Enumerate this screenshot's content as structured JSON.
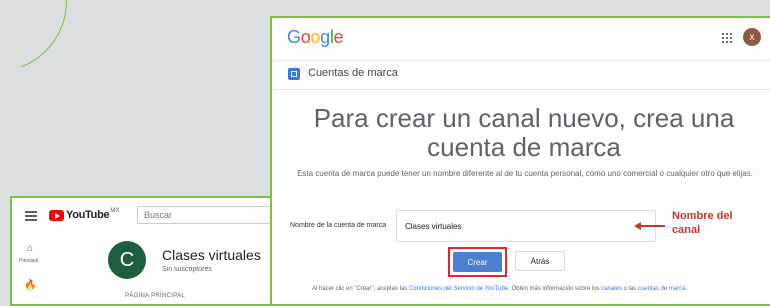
{
  "youtube": {
    "logo_text": "YouTube",
    "logo_region": "MX",
    "search_placeholder": "Buscar",
    "sidebar": [
      {
        "icon": "home-icon",
        "glyph": "⌂",
        "label": "Principal"
      },
      {
        "icon": "trending-icon",
        "glyph": "🔥",
        "label": ""
      }
    ],
    "channel": {
      "avatar_letter": "C",
      "name": "Clases virtuales",
      "subscribers": "Sin suscriptores",
      "page_label": "PÁGINA PRINCIPAL"
    }
  },
  "google": {
    "logo_letters": [
      {
        "ch": "G",
        "color": "#4285F4"
      },
      {
        "ch": "o",
        "color": "#EA4335"
      },
      {
        "ch": "o",
        "color": "#FBBC05"
      },
      {
        "ch": "g",
        "color": "#4285F4"
      },
      {
        "ch": "l",
        "color": "#34A853"
      },
      {
        "ch": "e",
        "color": "#EA4335"
      }
    ],
    "user_initial": "x",
    "brand_title": "Cuentas de marca",
    "headline": "Para crear un canal nuevo, crea una cuenta de marca",
    "description": "Esta cuenta de marca puede tener un nombre diferente al de tu cuenta personal, como uno comercial o cualquier otro que elijas.",
    "field_label": "Nombre de la cuenta de marca",
    "field_value": "Clases virtuales",
    "callout": "Nombre del canal",
    "create_button": "Crear",
    "back_button": "Atrás",
    "legal": {
      "prefix": "Al hacer clic en \"Crear\", aceptas las ",
      "terms_link": "Condiciones del Servicio de YouTube",
      "middle": ". Obtén más información sobre los ",
      "channels_link": "canales",
      "and": " o las ",
      "brand_link": "cuentas de marca",
      "suffix": "."
    }
  },
  "colors": {
    "accent_green": "#7cc242",
    "annotation_red": "#c0392b",
    "button_blue": "#4a7fd1"
  }
}
